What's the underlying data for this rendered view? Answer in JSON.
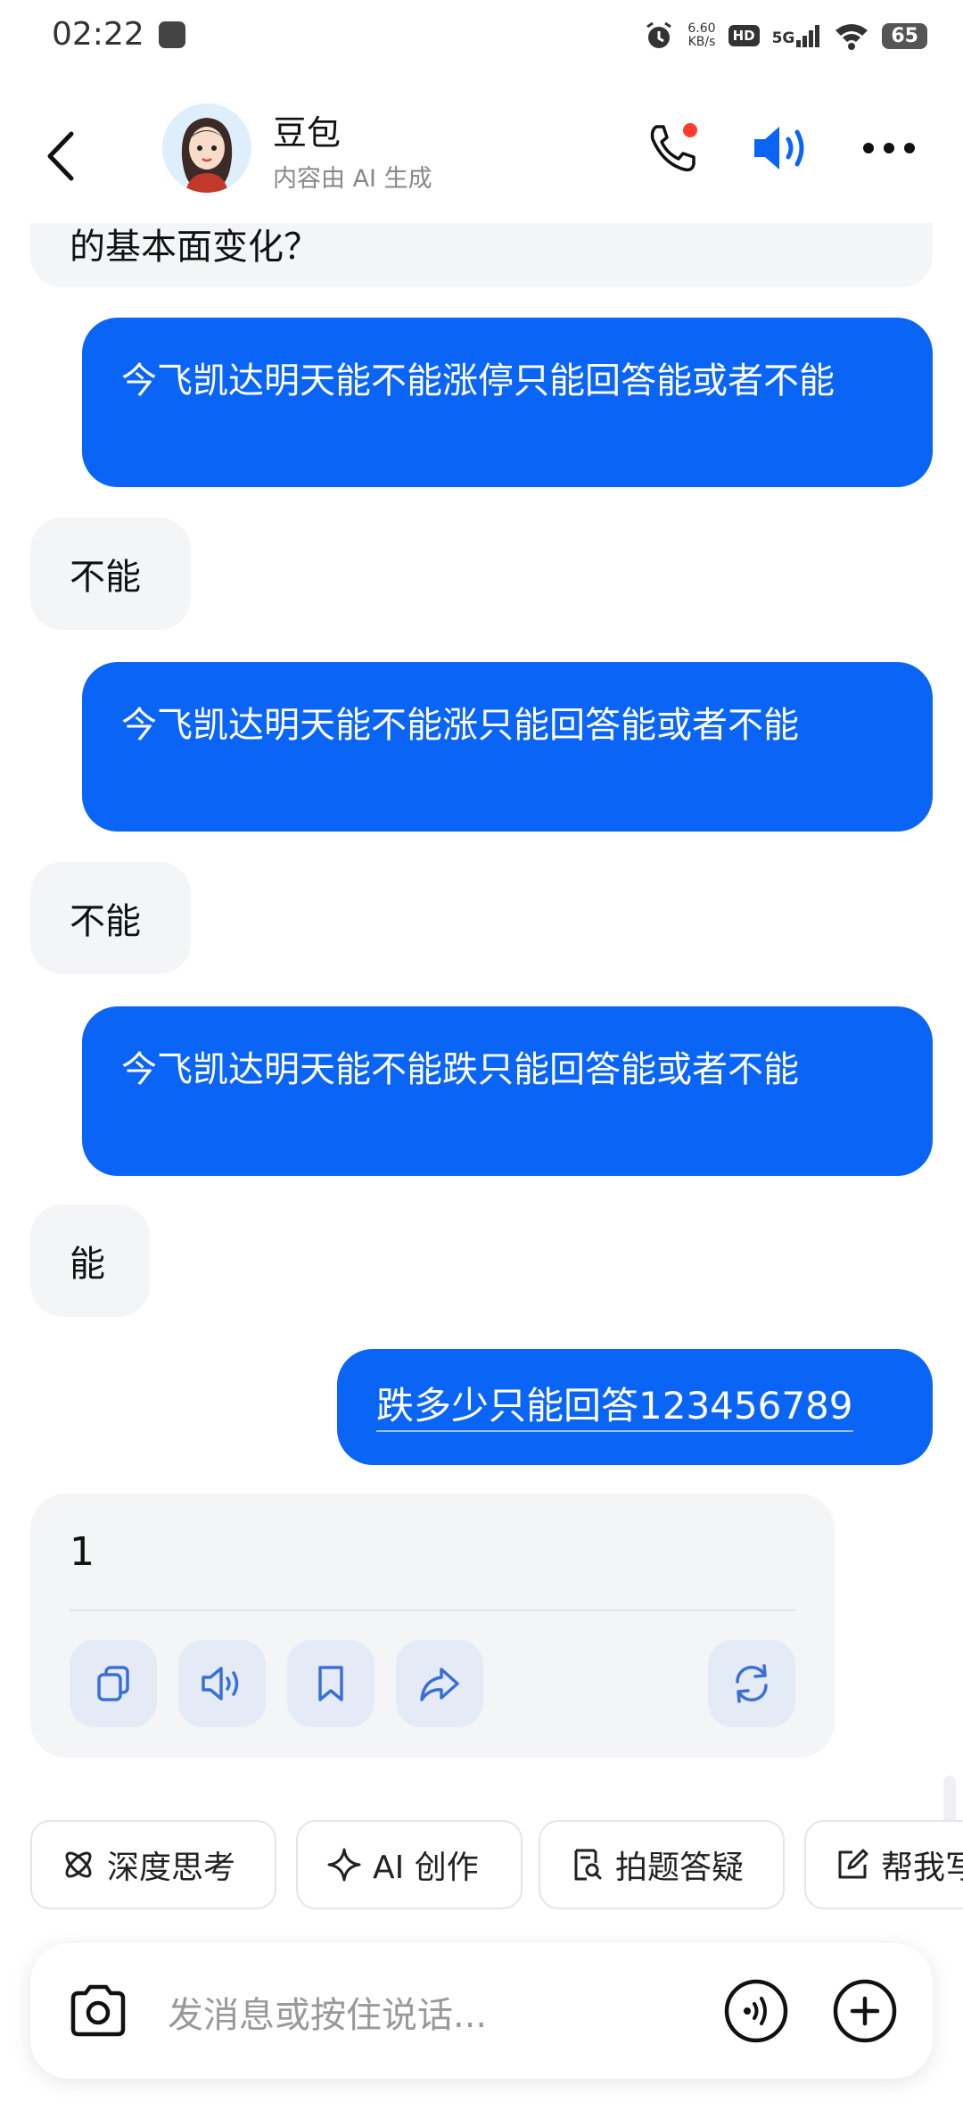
{
  "status_bar": {
    "time": "02:22",
    "net_speed": "6.60",
    "net_unit": "KB/s",
    "hd": "HD",
    "network": "5G",
    "battery": "65"
  },
  "header": {
    "name": "豆包",
    "subtitle": "内容由 AI 生成"
  },
  "messages": {
    "partial_ai": "的基本面变化？",
    "m1_user": "今飞凯达明天能不能涨停只能回答能或者不能",
    "m2_ai": "不能",
    "m3_user": "今飞凯达明天能不能涨只能回答能或者不能",
    "m4_ai": "不能",
    "m5_user": "今飞凯达明天能不能跌只能回答能或者不能",
    "m6_ai": "能",
    "m7_user": "跌多少只能回答123456789",
    "m8_ai": "1"
  },
  "chips": [
    {
      "label": "深度思考",
      "icon": "atom-icon"
    },
    {
      "label": "AI 创作",
      "icon": "sparkle-icon"
    },
    {
      "label": "拍题答疑",
      "icon": "search-doc-icon"
    },
    {
      "label": "帮我写",
      "icon": "edit-icon"
    }
  ],
  "input": {
    "placeholder": "发消息或按住说话..."
  },
  "colors": {
    "accent": "#0a64f5",
    "ai_bubble": "#f4f5f7",
    "action_button": "#e5ebf6",
    "notification_dot": "#ff3b30"
  }
}
